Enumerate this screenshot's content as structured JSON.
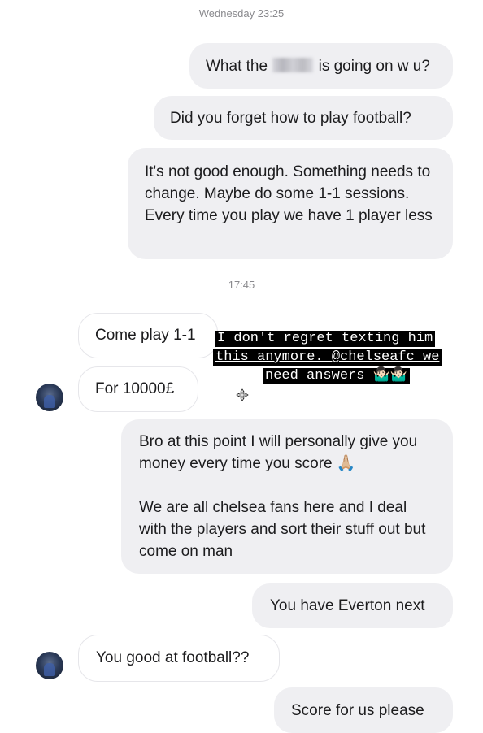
{
  "conversation": {
    "timestamp_1": "Wednesday 23:25",
    "timestamp_2": "17:45",
    "messages": [
      {
        "sender": "me",
        "text_before": "What the ",
        "text_after": " is going on w u?"
      },
      {
        "sender": "me",
        "text": "Did you forget how to play football?"
      },
      {
        "sender": "me",
        "text": "It's not good enough. Something needs to change. Maybe do some 1-1 sessions. Every time you play we have 1 player less"
      },
      {
        "sender": "them",
        "text": "Come play 1-1"
      },
      {
        "sender": "them",
        "text": "For 10000£"
      },
      {
        "sender": "me",
        "paragraph_1": "Bro at this point I will personally give you money every time you score 🙏🏼",
        "paragraph_2": "We are all chelsea fans here and I deal with the players and sort their stuff out but come on man"
      },
      {
        "sender": "me",
        "text": "You have Everton next"
      },
      {
        "sender": "them",
        "text": "You good at football??"
      },
      {
        "sender": "me",
        "text": "Score for us please"
      }
    ]
  },
  "story_caption": {
    "line_1": "I don't regret texting him",
    "line_2": "this anymore. @chelseafc we",
    "line_3": "need answers 🤷🏻‍♂️🤷🏻‍♂️"
  },
  "colors": {
    "outgoing_bubble": "#efeff2",
    "incoming_border": "#e6e6ea",
    "caption_background": "#000000"
  }
}
